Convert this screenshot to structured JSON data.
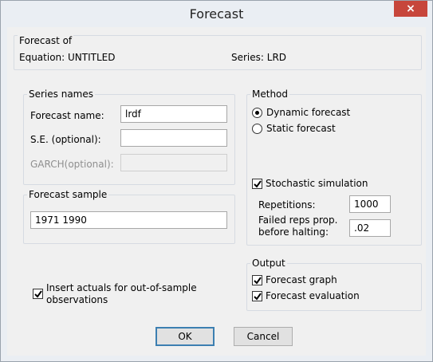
{
  "window": {
    "title": "Forecast",
    "close_glyph": "×"
  },
  "forecast_of": {
    "title": "Forecast of",
    "equation_label": "Equation: UNTITLED",
    "series_label": "Series: LRD"
  },
  "series_names": {
    "title": "Series names",
    "forecast_name_label": "Forecast name:",
    "forecast_name_value": "lrdf",
    "se_label": "S.E. (optional):",
    "se_value": "",
    "garch_label": "GARCH(optional):",
    "garch_value": ""
  },
  "method": {
    "title": "Method",
    "dynamic_label": "Dynamic forecast",
    "static_label": "Static forecast",
    "selected": "dynamic",
    "stochastic_label": "Stochastic simulation",
    "stochastic_checked": true,
    "repetitions_label": "Repetitions:",
    "repetitions_value": "1000",
    "failed_label_line1": "Failed reps prop.",
    "failed_label_line2": "before halting:",
    "failed_value": ".02"
  },
  "forecast_sample": {
    "title": "Forecast sample",
    "value": "1971 1990"
  },
  "insert_actuals": {
    "label_line1": "Insert actuals for out-of-sample",
    "label_line2": "observations",
    "checked": true
  },
  "output": {
    "title": "Output",
    "graph_label": "Forecast graph",
    "graph_checked": true,
    "evaluation_label": "Forecast evaluation",
    "evaluation_checked": true
  },
  "buttons": {
    "ok": "OK",
    "cancel": "Cancel"
  },
  "colors": {
    "close_button": "#c7463b",
    "titlebar": "#eaeef3",
    "client": "#f0f0f0"
  }
}
